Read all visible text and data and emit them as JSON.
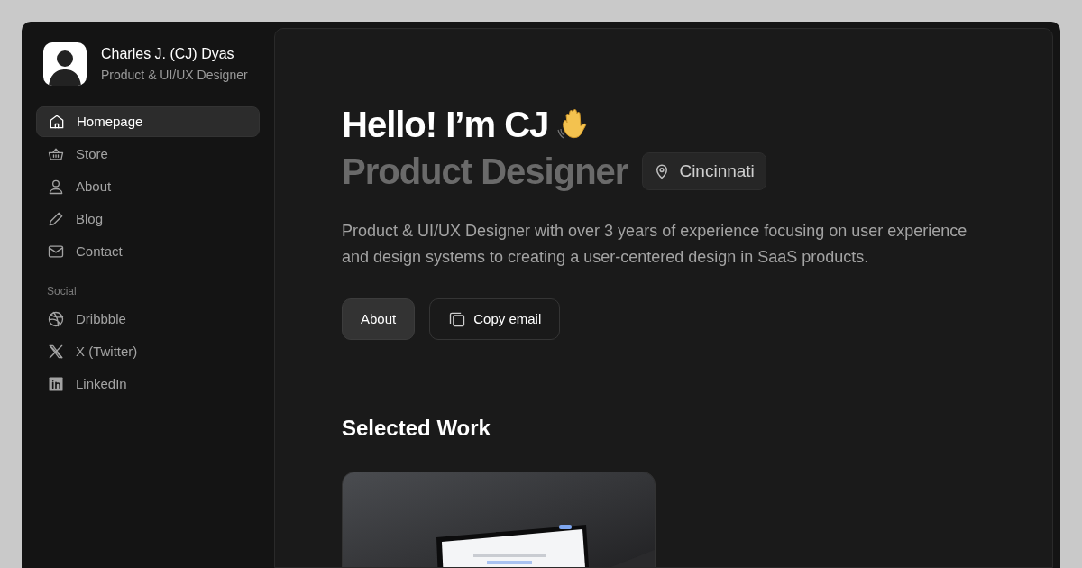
{
  "profile": {
    "name": "Charles J. (CJ) Dyas",
    "role": "Product & UI/UX Designer"
  },
  "nav": [
    {
      "label": "Homepage",
      "selected": true
    },
    {
      "label": "Store",
      "selected": false
    },
    {
      "label": "About",
      "selected": false
    },
    {
      "label": "Blog",
      "selected": false
    },
    {
      "label": "Contact",
      "selected": false
    }
  ],
  "social": {
    "heading": "Social",
    "items": [
      {
        "label": "Dribbble"
      },
      {
        "label": "X (Twitter)"
      },
      {
        "label": "LinkedIn"
      }
    ]
  },
  "hero": {
    "greeting": "Hello! I’m CJ",
    "title": "Product Designer",
    "location": "Cincinnati",
    "description": "Product & UI/UX Designer with over 3 years of experience focusing on user experience and design systems to creating a user-centered design in SaaS products.",
    "buttons": [
      {
        "label": "About",
        "kind": "filled"
      },
      {
        "label": "Copy email",
        "kind": "outline"
      }
    ]
  },
  "work": {
    "heading": "Selected Work"
  }
}
